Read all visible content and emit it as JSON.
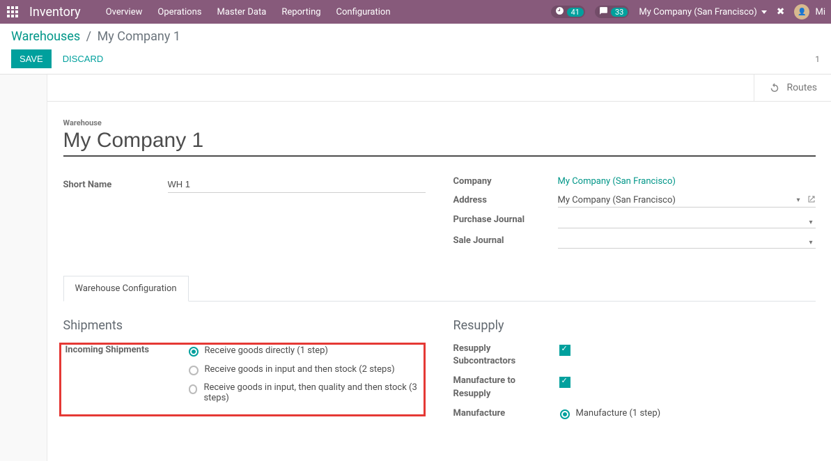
{
  "navbar": {
    "brand": "Inventory",
    "menu": [
      "Overview",
      "Operations",
      "Master Data",
      "Reporting",
      "Configuration"
    ],
    "activity_count": "41",
    "msg_count": "33",
    "company": "My Company (San Francisco)",
    "user_short": "Mi"
  },
  "breadcrumb": {
    "root": "Warehouses",
    "current": "My Company 1"
  },
  "controls": {
    "save": "SAVE",
    "discard": "DISCARD",
    "pager": "1"
  },
  "buttonbox": {
    "routes": "Routes"
  },
  "form": {
    "title_label": "Warehouse",
    "name": "My Company 1",
    "left": {
      "short_name_label": "Short Name",
      "short_name": "WH 1"
    },
    "right": {
      "company_label": "Company",
      "company_value": "My Company (San Francisco)",
      "address_label": "Address",
      "address_value": "My Company (San Francisco)",
      "purchase_journal_label": "Purchase Journal",
      "sale_journal_label": "Sale Journal"
    }
  },
  "tabs": {
    "wh_config": "Warehouse Configuration"
  },
  "shipments": {
    "heading": "Shipments",
    "incoming_label": "Incoming Shipments",
    "options": [
      "Receive goods directly (1 step)",
      "Receive goods in input and then stock (2 steps)",
      "Receive goods in input, then quality and then stock (3 steps)"
    ]
  },
  "resupply": {
    "heading": "Resupply",
    "sub_label": "Resupply Subcontractors",
    "mfg_to_label": "Manufacture to Resupply",
    "mfg_label": "Manufacture",
    "mfg_option": "Manufacture (1 step)"
  }
}
